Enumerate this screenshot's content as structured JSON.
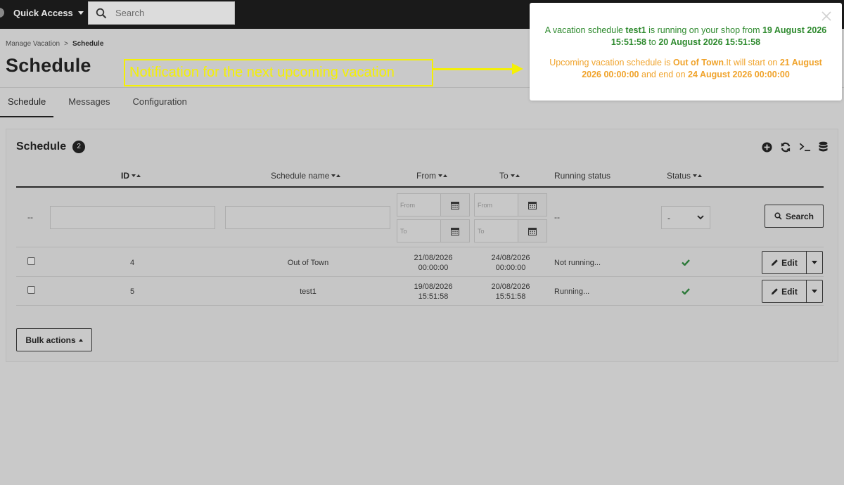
{
  "topbar": {
    "quick_access": "Quick Access",
    "search_placeholder": "Search"
  },
  "breadcrumb": {
    "parent": "Manage Vacation",
    "separator": ">",
    "current": "Schedule"
  },
  "page": {
    "title": "Schedule"
  },
  "tabs": [
    {
      "label": "Schedule",
      "active": true
    },
    {
      "label": "Messages",
      "active": false
    },
    {
      "label": "Configuration",
      "active": false
    }
  ],
  "panel": {
    "title": "Schedule",
    "count": "2",
    "actions": [
      "add-icon",
      "refresh-icon",
      "terminal-icon",
      "database-icon"
    ]
  },
  "table": {
    "headers": {
      "id": "ID",
      "name": "Schedule name",
      "from": "From",
      "to": "To",
      "running": "Running status",
      "status": "Status"
    },
    "filters": {
      "dash": "--",
      "from_placeholder": "From",
      "to_placeholder": "To",
      "running_dash": "--",
      "status_value": "-",
      "search_label": "Search"
    },
    "rows": [
      {
        "id": "4",
        "name": "Out of Town",
        "from_date": "21/08/2026",
        "from_time": "00:00:00",
        "to_date": "24/08/2026",
        "to_time": "00:00:00",
        "running": "Not running...",
        "status": "enabled",
        "edit": "Edit"
      },
      {
        "id": "5",
        "name": "test1",
        "from_date": "19/08/2026",
        "from_time": "15:51:58",
        "to_date": "20/08/2026",
        "to_time": "15:51:58",
        "running": "Running...",
        "status": "enabled",
        "edit": "Edit"
      }
    ]
  },
  "bulk_actions": "Bulk actions",
  "annotation": {
    "text": "Notification for the next upcoming vacation"
  },
  "notification": {
    "current": {
      "p1": "A vacation schedule ",
      "name": "test1",
      "p2": " is running on your shop from ",
      "start": "19 August 2026 15:51:58",
      "p3": " to ",
      "end": "20 August 2026 15:51:58"
    },
    "upcoming": {
      "p1": "Upcoming vacation schedule is ",
      "name": "Out of Town",
      "p2": ".It will start on ",
      "start": "21 August 2026 00:00:00",
      "p3": " and end on ",
      "end": "24 August 2026 00:00:00"
    }
  },
  "colors": {
    "notification_green": "#2e8a2e",
    "notification_orange": "#f0a32b",
    "annotation_yellow": "#f4f005",
    "status_check": "#2d7a3a"
  }
}
